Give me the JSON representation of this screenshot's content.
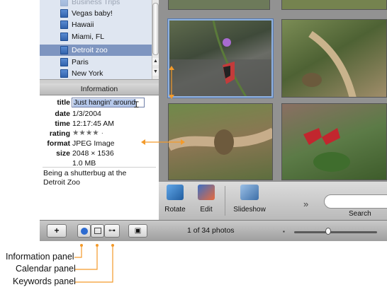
{
  "albums": [
    {
      "label": "Business Trips",
      "selected": false,
      "faded": true
    },
    {
      "label": "Vegas baby!",
      "selected": false
    },
    {
      "label": "Hawaii",
      "selected": false
    },
    {
      "label": "Miami, FL",
      "selected": false
    },
    {
      "label": "Detroit zoo",
      "selected": true
    },
    {
      "label": "Paris",
      "selected": false
    },
    {
      "label": "New York",
      "selected": false
    }
  ],
  "info": {
    "header": "Information",
    "title_key": "title",
    "title_value": "Just hangin' around",
    "date_key": "date",
    "date_value": "1/3/2004",
    "time_key": "time",
    "time_value": "12:17:45 AM",
    "rating_key": "rating",
    "rating_value": "★★★★ ·",
    "format_key": "format",
    "format_value": "JPEG Image",
    "size_key": "size",
    "size_value": "2048 × 1536",
    "filesize_value": "1.0 MB",
    "comments": "Being a shutterbug at the Detroit Zoo"
  },
  "toolbar": {
    "rotate_label": "Rotate",
    "edit_label": "Edit",
    "slideshow_label": "Slideshow",
    "overflow_label": "»",
    "search_label": "Search"
  },
  "bottom": {
    "add_label": "+",
    "photo_count": "1 of 34 photos"
  },
  "callouts": {
    "information": "Information panel",
    "calendar": "Calendar panel",
    "keywords": "Keywords panel"
  },
  "colors": {
    "callout": "#f39a2a",
    "selection": "#7e95c0"
  }
}
